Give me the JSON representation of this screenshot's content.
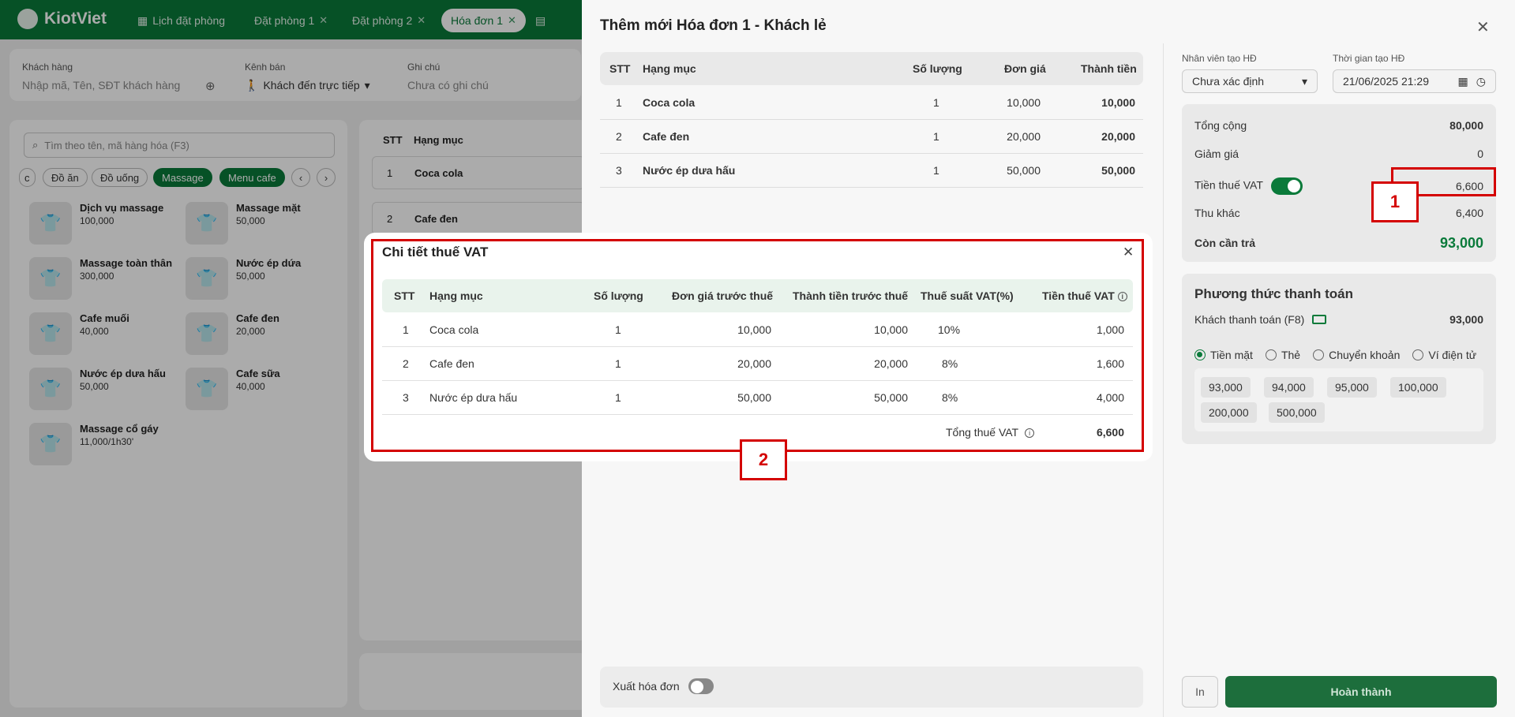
{
  "app": {
    "logo": "KiotViet"
  },
  "tabs": [
    {
      "label": "Lịch đặt phòng"
    },
    {
      "label": "Đặt phòng 1"
    },
    {
      "label": "Đặt phòng 2"
    },
    {
      "label": "Hóa đơn 1"
    }
  ],
  "filters": {
    "customer_label": "Khách hàng",
    "customer_placeholder": "Nhập mã, Tên, SĐT khách hàng",
    "channel_label": "Kênh bán",
    "channel_value": "Khách đến trực tiếp",
    "note_label": "Ghi chú",
    "note_placeholder": "Chưa có ghi chú"
  },
  "search": {
    "placeholder": "Tìm theo tên, mã hàng hóa (F3)"
  },
  "categories": [
    "c",
    "Đồ ăn",
    "Đồ uống",
    "Massage",
    "Menu cafe"
  ],
  "products": [
    {
      "name": "Dịch vụ massage",
      "price": "100,000"
    },
    {
      "name": "Massage mặt",
      "price": "50,000"
    },
    {
      "name": "Massage toàn thân",
      "price": "300,000"
    },
    {
      "name": "Nước ép dứa",
      "price": "50,000"
    },
    {
      "name": "Cafe muối",
      "price": "40,000"
    },
    {
      "name": "Cafe đen",
      "price": "20,000"
    },
    {
      "name": "Nước ép dưa hấu",
      "price": "50,000"
    },
    {
      "name": "Cafe sữa",
      "price": "40,000"
    },
    {
      "name": "Massage cổ gáy",
      "price": "11,000/1h30'"
    }
  ],
  "bg_order": {
    "headers": {
      "stt": "STT",
      "item": "Hạng mục"
    },
    "rows": [
      {
        "stt": "1",
        "item": "Coca cola"
      },
      {
        "stt": "2",
        "item": "Cafe đen"
      }
    ]
  },
  "panel": {
    "title": "Thêm mới Hóa đơn 1 - Khách lẻ",
    "headers": {
      "stt": "STT",
      "item": "Hạng mục",
      "qty": "Số lượng",
      "price": "Đơn giá",
      "total": "Thành tiền"
    },
    "rows": [
      {
        "stt": "1",
        "item": "Coca cola",
        "qty": "1",
        "price": "10,000",
        "total": "10,000"
      },
      {
        "stt": "2",
        "item": "Cafe đen",
        "qty": "1",
        "price": "20,000",
        "total": "20,000"
      },
      {
        "stt": "3",
        "item": "Nước ép dưa hấu",
        "qty": "1",
        "price": "50,000",
        "total": "50,000"
      }
    ],
    "staff_label": "Nhân viên tạo HĐ",
    "staff_value": "Chưa xác định",
    "time_label": "Thời gian tạo HĐ",
    "time_value": "21/06/2025 21:29",
    "summary": {
      "total_label": "Tổng cộng",
      "total": "80,000",
      "discount_label": "Giảm giá",
      "discount": "0",
      "vat_label": "Tiền thuế VAT",
      "vat": "6,600",
      "other_label": "Thu khác",
      "other": "6,400",
      "due_label": "Còn cần trả",
      "due": "93,000"
    },
    "payment": {
      "title": "Phương thức thanh toán",
      "customer_pay_label": "Khách thanh toán (F8)",
      "customer_pay": "93,000",
      "methods": [
        "Tiền mặt",
        "Thẻ",
        "Chuyển khoản",
        "Ví điện tử"
      ],
      "amounts": [
        "93,000",
        "94,000",
        "95,000",
        "100,000",
        "200,000",
        "500,000"
      ]
    },
    "invoice_label": "Xuất hóa đơn",
    "print_label": "In",
    "done_label": "Hoàn thành"
  },
  "modal": {
    "title": "Chi tiết thuế VAT",
    "headers": {
      "stt": "STT",
      "item": "Hạng mục",
      "qty": "Số lượng",
      "price": "Đơn giá trước thuế",
      "amount": "Thành tiền trước thuế",
      "rate": "Thuế suất VAT(%)",
      "vat": "Tiền thuế VAT"
    },
    "rows": [
      {
        "stt": "1",
        "item": "Coca cola",
        "qty": "1",
        "price": "10,000",
        "amount": "10,000",
        "rate": "10%",
        "vat": "1,000"
      },
      {
        "stt": "2",
        "item": "Cafe đen",
        "qty": "1",
        "price": "20,000",
        "amount": "20,000",
        "rate": "8%",
        "vat": "1,600"
      },
      {
        "stt": "3",
        "item": "Nước ép dưa hấu",
        "qty": "1",
        "price": "50,000",
        "amount": "50,000",
        "rate": "8%",
        "vat": "4,000"
      }
    ],
    "total_label": "Tổng thuế VAT",
    "total_value": "6,600"
  },
  "callouts": {
    "one": "1",
    "two": "2"
  },
  "colors": {
    "brand": "#0a7a3a",
    "highlight": "#d40000"
  }
}
